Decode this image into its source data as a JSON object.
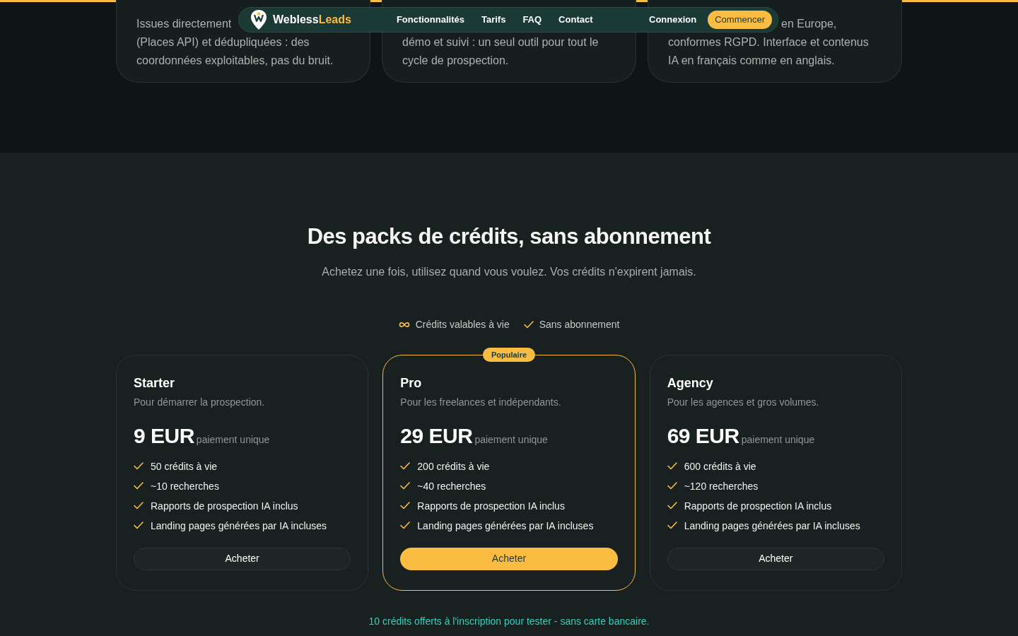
{
  "features": [
    {
      "lines": [
        "Issues directement",
        "(Places API) et dédupliquées : des",
        "coordonnées exploitables, pas du bruit."
      ]
    },
    {
      "lines": [
        "démo et suivi : un seul outil pour tout le",
        "cycle de prospection."
      ]
    },
    {
      "lines": [
        "en Europe,",
        "conformes RGPD. Interface et contenus",
        "IA en français comme en anglais."
      ],
      "offset_first": true
    }
  ],
  "nav": {
    "brand": "Webless",
    "brand_accent": "Leads",
    "links": [
      "Fonctionnalités",
      "Tarifs",
      "FAQ",
      "Contact"
    ],
    "login": "Connexion",
    "cta": "Commencer"
  },
  "pricing": {
    "title": "Des packs de crédits, sans abonnement",
    "subtitle": "Achetez une fois, utilisez quand vous voulez. Vos crédits n'expirent jamais.",
    "perks": [
      {
        "kind": "infinity",
        "label": "Crédits valables à vie"
      },
      {
        "kind": "check",
        "label": "Sans abonnement"
      }
    ],
    "plans": [
      {
        "name": "Starter",
        "description": "Pour démarrer la prospection.",
        "price": "9 EUR",
        "price_note": "paiement unique",
        "features": [
          "50 crédits à vie",
          "~10 recherches",
          "Rapports de prospection IA inclus",
          "Landing pages générées par IA incluses"
        ],
        "button": "Acheter",
        "highlighted": false
      },
      {
        "name": "Pro",
        "badge": "Populaire",
        "description": "Pour les freelances et indépendants.",
        "price": "29 EUR",
        "price_note": "paiement unique",
        "features": [
          "200 crédits à vie",
          "~40 recherches",
          "Rapports de prospection IA inclus",
          "Landing pages générées par IA incluses"
        ],
        "button": "Acheter",
        "highlighted": true
      },
      {
        "name": "Agency",
        "description": "Pour les agences et gros volumes.",
        "price": "69 EUR",
        "price_note": "paiement unique",
        "features": [
          "600 crédits à vie",
          "~120 recherches",
          "Rapports de prospection IA inclus",
          "Landing pages générées par IA incluses"
        ],
        "button": "Acheter",
        "highlighted": false
      }
    ],
    "footnote": "10 crédits offerts à l'inscription pour tester - sans carte bancaire."
  }
}
